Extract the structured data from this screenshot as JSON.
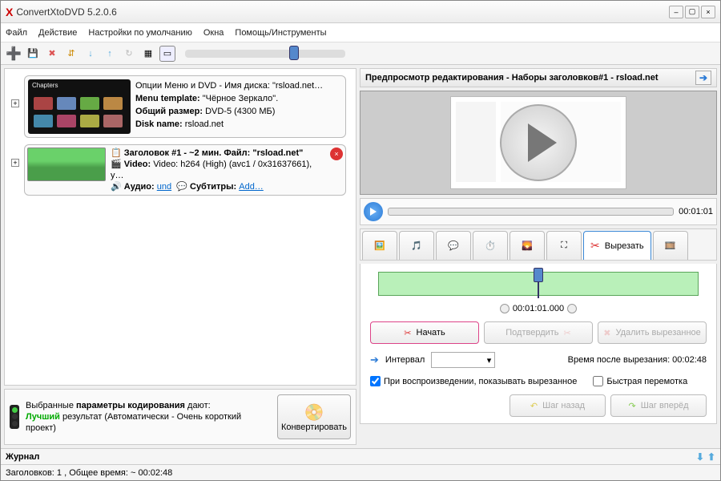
{
  "app": {
    "title": "ConvertXtoDVD 5.2.0.6"
  },
  "menu": {
    "file": "Файл",
    "action": "Действие",
    "defaults": "Настройки по умолчанию",
    "windows": "Окна",
    "help": "Помощь/Инструменты"
  },
  "previewbar": {
    "title": "Предпросмотр редактирования - Наборы заголовков#1 - rsload.net"
  },
  "dvd": {
    "line1": "Опции Меню и DVD - Имя диска: \"rsload.net…",
    "tpl_label": "Menu template:",
    "tpl_value": "\"Чёрное Зеркало\".",
    "size_label": "Общий размер:",
    "size_value": "DVD-5 (4300 МБ)",
    "disk_label": "Disk name:",
    "disk_value": "rsload.net",
    "chapters": "Chapters"
  },
  "title": {
    "header": "Заголовок #1 - ~2 мин. Файл: \"rsload.net\"",
    "video_label": "Video:",
    "video_value": "Video: h264 (High) (avc1 / 0x31637661), y…",
    "audio_label": "Аудио:",
    "audio_value": "und",
    "subs_label": "Субтитры:",
    "subs_value": "Add…"
  },
  "encode": {
    "text1": "Выбранные ",
    "text2": "параметры кодирования",
    "text3": " дают:",
    "quality": "Лучший",
    "text4": " результат (Автоматически - Очень короткий проект)",
    "convert_btn": "Конвертировать"
  },
  "playback": {
    "time": "00:01:01"
  },
  "tabs": {
    "cut_label": "Вырезать"
  },
  "cut": {
    "timecode": "00:01:01.000",
    "start": "Начать",
    "confirm": "Подтвердить",
    "delete": "Удалить вырезанное",
    "interval": "Интервал",
    "after": "Время после вырезания: 00:02:48",
    "show_cut": "При воспроизведении, показывать вырезанное",
    "fast": "Быстрая перемотка",
    "back": "Шаг назад",
    "fwd": "Шаг вперёд"
  },
  "journal": {
    "label": "Журнал"
  },
  "status": {
    "text": "Заголовков: 1 , Общее время: ~ 00:02:48"
  }
}
